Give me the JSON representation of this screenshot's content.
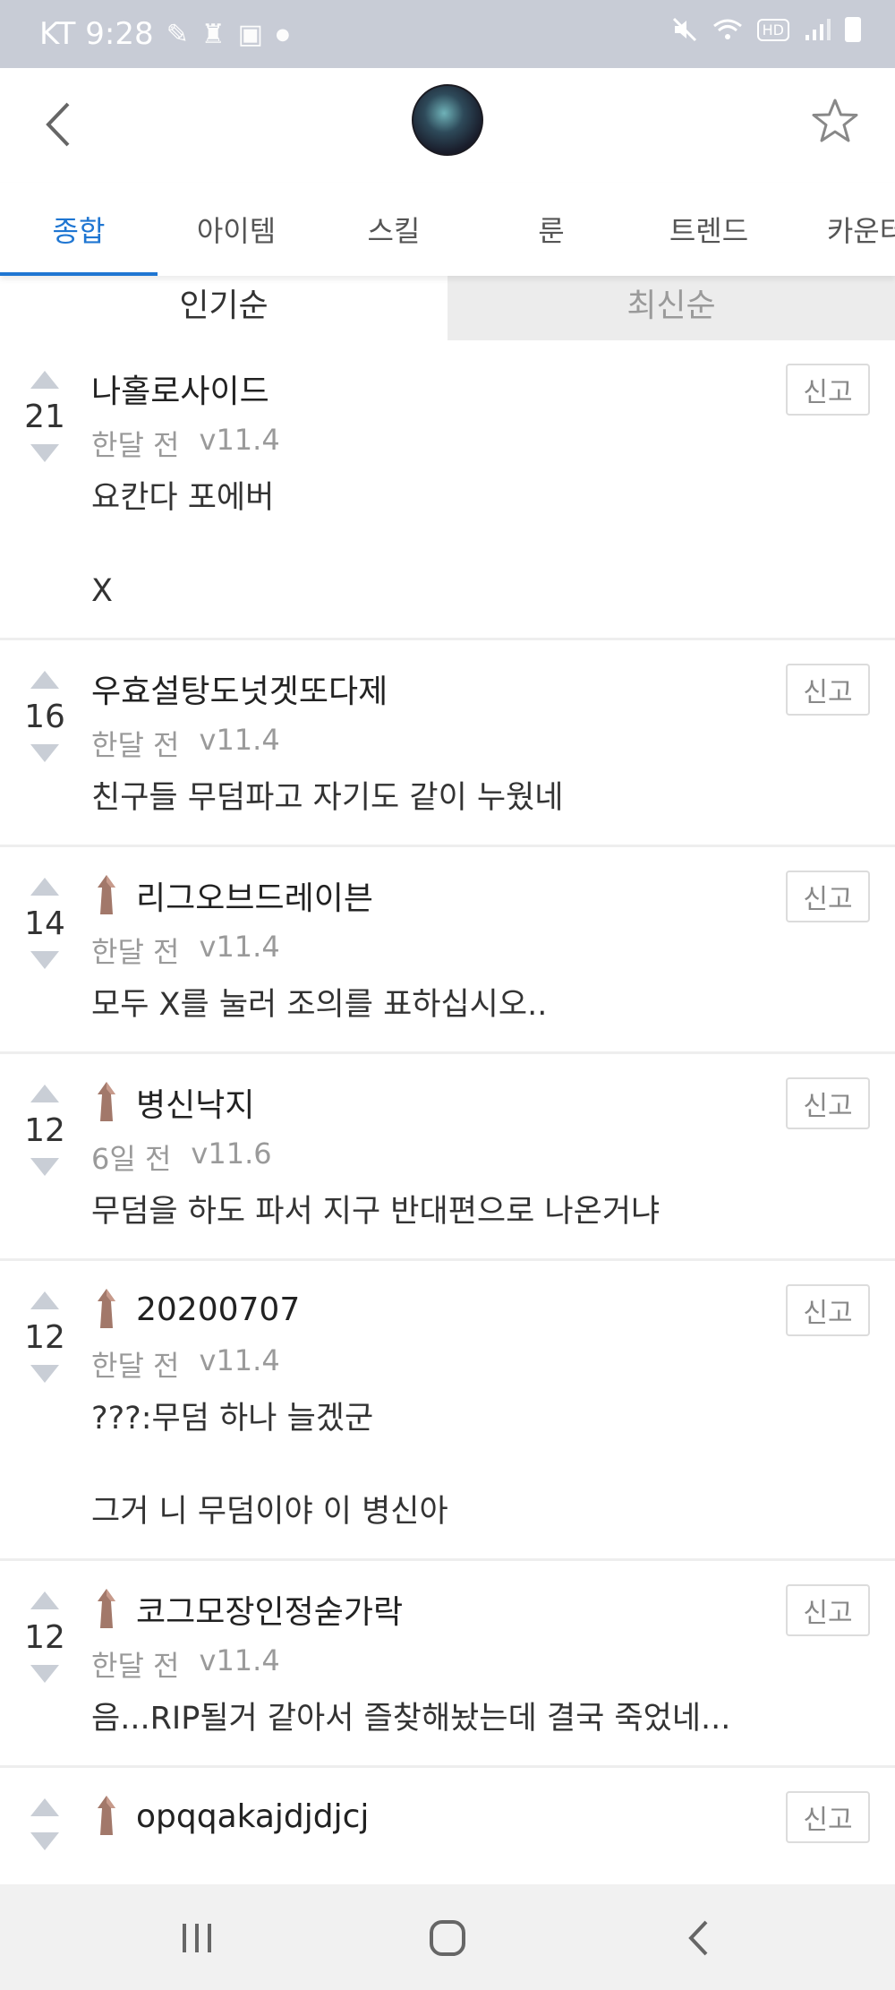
{
  "status_bar": {
    "carrier_time": "KT 9:28",
    "hd_label": "HD"
  },
  "tabs": [
    {
      "label": "종합",
      "active": true
    },
    {
      "label": "아이템",
      "active": false
    },
    {
      "label": "스킬",
      "active": false
    },
    {
      "label": "룬",
      "active": false
    },
    {
      "label": "트렌드",
      "active": false
    },
    {
      "label": "카운터",
      "active": false
    }
  ],
  "sort": {
    "popular_label": "인기순",
    "newest_label": "최신순"
  },
  "report_label": "신고",
  "comments": [
    {
      "votes": "21",
      "author": "나홀로사이드",
      "has_tier_icon": false,
      "time": "한달 전",
      "version": "v11.4",
      "text": "요칸다 포에버\n\nX"
    },
    {
      "votes": "16",
      "author": "우효설탕도넛겟또다제",
      "has_tier_icon": false,
      "time": "한달 전",
      "version": "v11.4",
      "text": "친구들 무덤파고 자기도 같이 누웠네"
    },
    {
      "votes": "14",
      "author": "리그오브드레이븐",
      "has_tier_icon": true,
      "time": "한달 전",
      "version": "v11.4",
      "text": "모두 X를 눌러 조의를 표하십시오.."
    },
    {
      "votes": "12",
      "author": "병신낙지",
      "has_tier_icon": true,
      "time": "6일 전",
      "version": "v11.6",
      "text": "무덤을 하도 파서 지구 반대편으로 나온거냐"
    },
    {
      "votes": "12",
      "author": "20200707",
      "has_tier_icon": true,
      "time": "한달 전",
      "version": "v11.4",
      "text": "???:무덤 하나 늘겠군\n\n그거 니 무덤이야 이 병신아"
    },
    {
      "votes": "12",
      "author": "코그모장인정숟가락",
      "has_tier_icon": true,
      "time": "한달 전",
      "version": "v11.4",
      "text": "음...RIP될거 같아서 즐찾해놨는데 결국 죽었네..."
    },
    {
      "votes": "",
      "author": "opqqakajdjdjcj",
      "has_tier_icon": true,
      "time": "",
      "version": "",
      "text": ""
    }
  ],
  "colors": {
    "accent": "#1f76d2",
    "status_bar_bg": "#c8ccd6",
    "vote_arrow": "#c9ced6"
  },
  "icons": {
    "back": "chevron-left-icon",
    "favorite": "star-outline-icon",
    "nav_recents": "recents-icon",
    "nav_home": "home-icon",
    "nav_back": "back-icon"
  }
}
